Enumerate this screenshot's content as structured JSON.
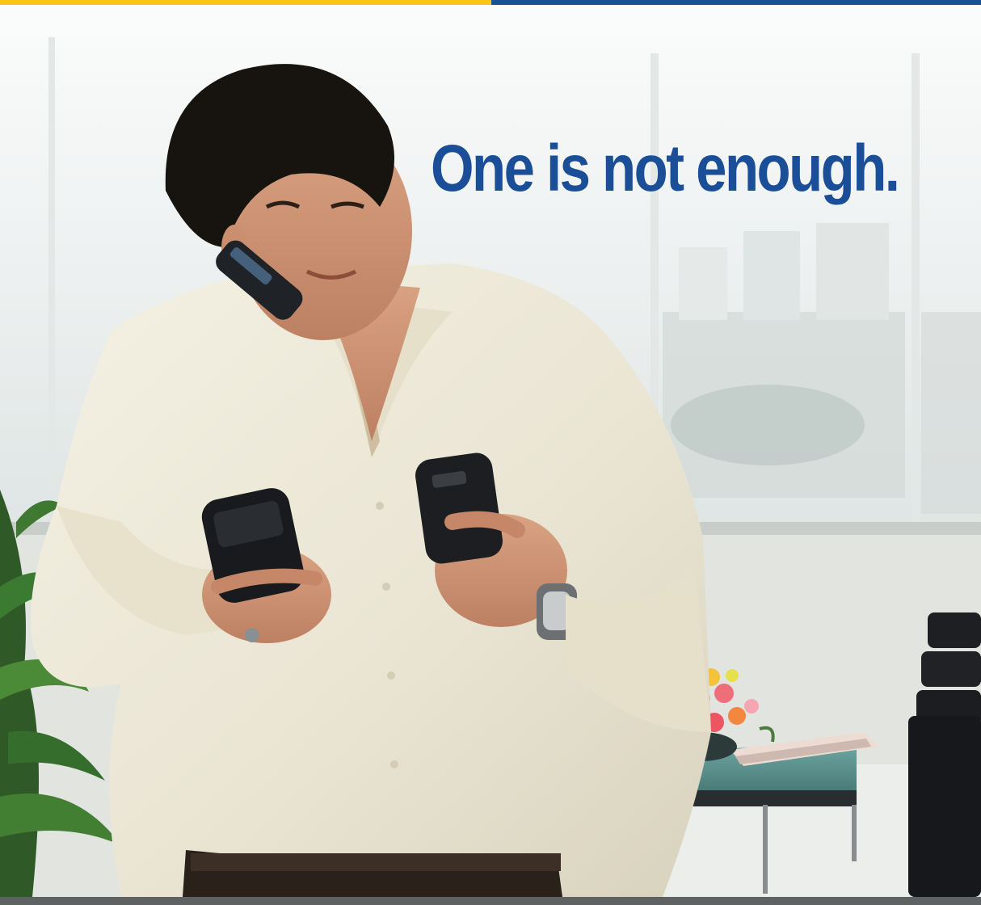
{
  "headline": "One is not enough.",
  "colors": {
    "headline": "#1a4f98",
    "top_bar_left": "#f7c51b",
    "top_bar_right": "#1a4f98",
    "bottom_strip": "#5e6263"
  },
  "scene_description_icons": [
    "office-window",
    "man-with-three-phones",
    "plant",
    "glass-table",
    "flowers",
    "chairs"
  ]
}
